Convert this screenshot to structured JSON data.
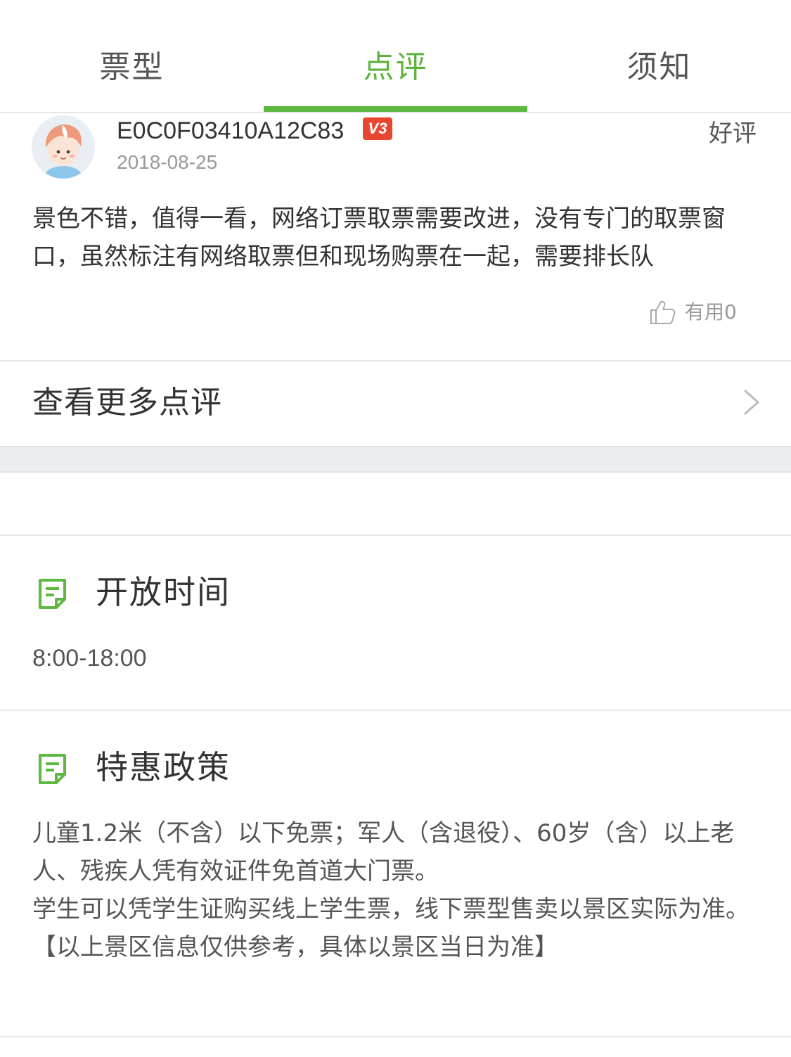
{
  "tabs": [
    {
      "label": "票型",
      "active": false
    },
    {
      "label": "点评",
      "active": true
    },
    {
      "label": "须知",
      "active": false
    }
  ],
  "review": {
    "username": "E0C0F03410A12C83",
    "level_badge": "V3",
    "date": "2018-08-25",
    "rating": "好评",
    "text": "景色不错，值得一看，网络订票取票需要改进，没有专门的取票窗口，虽然标注有网络取票但和现场购票在一起，需要排长队",
    "useful_label": "有用0"
  },
  "more_reviews_label": "查看更多点评",
  "open_hours": {
    "title": "开放时间",
    "value": "8:00-18:00"
  },
  "policy": {
    "title": "特惠政策",
    "lines": [
      "儿童1.2米（不含）以下免票；军人（含退役）、60岁（含）以上老人、残疾人凭有效证件免首道大门票。",
      "学生可以凭学生证购买线上学生票，线下票型售卖以景区实际为准。",
      "【以上景区信息仅供参考，具体以景区当日为准】"
    ]
  },
  "colors": {
    "accent_green": "#5cb83f",
    "badge_red": "#e8472f",
    "divider": "#e6e6e6",
    "gap_bg": "#ebedf0"
  },
  "icons": [
    "avatar-cartoon",
    "thumb-up-icon",
    "chevron-right-icon",
    "note-icon"
  ]
}
